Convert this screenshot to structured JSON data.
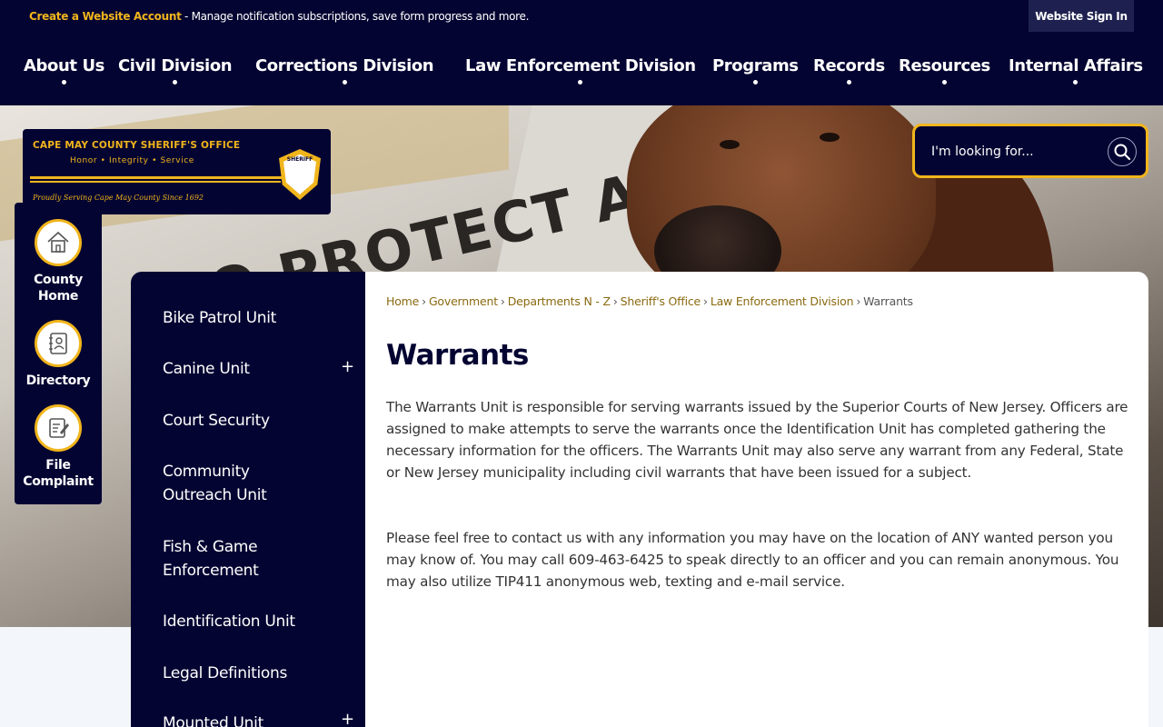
{
  "utility": {
    "create_account": "Create a Website Account",
    "description": " - Manage notification subscriptions, save form progress and more.",
    "sign_in": "Website Sign In"
  },
  "nav": [
    {
      "label": "About Us"
    },
    {
      "label": "Civil Division"
    },
    {
      "label": "Corrections Division"
    },
    {
      "label": "Law Enforcement Division"
    },
    {
      "label": "Programs"
    },
    {
      "label": "Records"
    },
    {
      "label": "Resources"
    },
    {
      "label": "Internal Affairs"
    }
  ],
  "hero": {
    "vehicle_text": "TO PROTECT AN"
  },
  "logo": {
    "line1": "CAPE MAY COUNTY SHERIFF'S OFFICE",
    "line2": "Honor • Integrity • Service",
    "line3": "Proudly Serving Cape May County Since 1692",
    "badge": "SHERIFF"
  },
  "search": {
    "placeholder": "I'm looking for..."
  },
  "quick_links": [
    {
      "label": "County Home",
      "icon": "house-icon"
    },
    {
      "label": "Directory",
      "icon": "address-book-icon"
    },
    {
      "label": "File Complaint",
      "icon": "form-edit-icon"
    }
  ],
  "side_nav": [
    {
      "label": "Bike Patrol Unit",
      "expandable": false
    },
    {
      "label": "Canine Unit",
      "expandable": true
    },
    {
      "label": "Court Security",
      "expandable": false
    },
    {
      "label": "Community Outreach Unit",
      "expandable": false
    },
    {
      "label": "Fish & Game Enforcement",
      "expandable": false
    },
    {
      "label": "Identification Unit",
      "expandable": false
    },
    {
      "label": "Legal Definitions",
      "expandable": false
    },
    {
      "label": "Mounted Unit",
      "expandable": true
    }
  ],
  "breadcrumb": [
    "Home",
    "Government",
    "Departments N - Z",
    "Sheriff's Office",
    "Law Enforcement Division",
    "Warrants"
  ],
  "page": {
    "title": "Warrants",
    "para1": "The Warrants Unit is responsible for serving warrants issued by the Superior Courts of New Jersey. Officers are assigned to make attempts to serve the warrants once the Identification Unit has completed gathering the necessary information for the officers. The Warrants Unit may also serve any warrant from any Federal, State or New Jersey municipality including civil warrants that have been issued for a subject.",
    "para2": "Please feel free to contact us with any information you may have on the location of ANY wanted person you may know of. You may call 609-463-6425 to speak directly to an officer and you can remain anonymous. You may also utilize TIP411 anonymous web, texting and e-mail service."
  },
  "colors": {
    "navy": "#040432",
    "gold": "#f1b51c",
    "link": "#8a6a10"
  }
}
